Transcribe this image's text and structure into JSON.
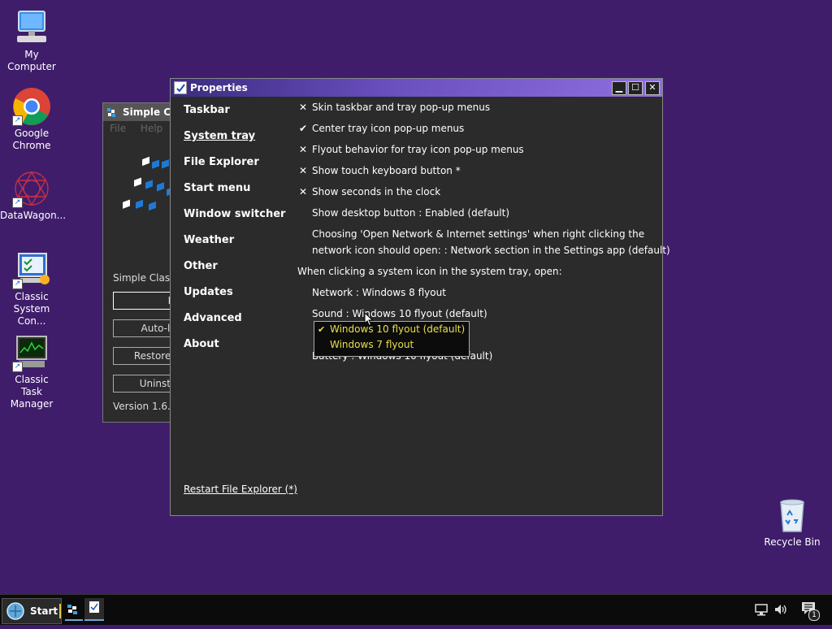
{
  "desktop": {
    "icons": [
      {
        "label": "My Computer",
        "icon": "computer-icon"
      },
      {
        "label": "Google Chrome",
        "icon": "chrome-icon"
      },
      {
        "label": "DataWagon...",
        "icon": "datawagon-icon"
      },
      {
        "label": "Classic System Con...",
        "icon": "control-panel-icon"
      },
      {
        "label": "Classic Task Manager",
        "icon": "task-manager-icon"
      },
      {
        "label": "Recycle Bin",
        "icon": "recycle-bin-icon"
      }
    ]
  },
  "background_window": {
    "title": "Simple Cla",
    "menu": [
      "File",
      "Help"
    ],
    "text": "Simple Classic",
    "buttons": [
      "Ins",
      "Auto-loa",
      "Restore w",
      "Uninstall"
    ],
    "version": "Version 1.6.0 ("
  },
  "properties": {
    "title": "Properties",
    "nav": [
      "Taskbar",
      "System tray",
      "File Explorer",
      "Start menu",
      "Window switcher",
      "Weather",
      "Other",
      "Updates",
      "Advanced",
      "About"
    ],
    "active_nav": "System tray",
    "options": [
      {
        "mark": "✕",
        "label": "Skin taskbar and tray pop-up menus"
      },
      {
        "mark": "✔",
        "label": "Center tray icon pop-up menus"
      },
      {
        "mark": "✕",
        "label": "Flyout behavior for tray icon pop-up menus"
      },
      {
        "mark": "✕",
        "label": "Show touch keyboard button *"
      },
      {
        "mark": "✕",
        "label": "Show seconds in the clock"
      },
      {
        "mark": "",
        "label": "Show desktop button : Enabled (default)"
      },
      {
        "mark": "",
        "label": "Choosing 'Open Network & Internet settings' when right clicking the"
      },
      {
        "mark": "",
        "label": "network icon should open: : Network section in the Settings app (default)"
      }
    ],
    "section_label": "When clicking a system icon in the system tray, open:",
    "network": "Network : Windows 8 flyout",
    "sound": "Sound : Windows 10 flyout (default)",
    "battery": "Battery : Windows 10 flyout (default)",
    "dropdown": {
      "items": [
        {
          "mark": "✔",
          "label": "Windows 10 flyout (default)"
        },
        {
          "mark": "",
          "label": "Windows 7 flyout"
        }
      ]
    },
    "footer_link": "Restart File Explorer (*)"
  },
  "taskbar": {
    "start_label": "Start",
    "tray": {
      "network_icon": "network-icon",
      "volume_icon": "volume-icon",
      "notification_count": "1"
    }
  }
}
